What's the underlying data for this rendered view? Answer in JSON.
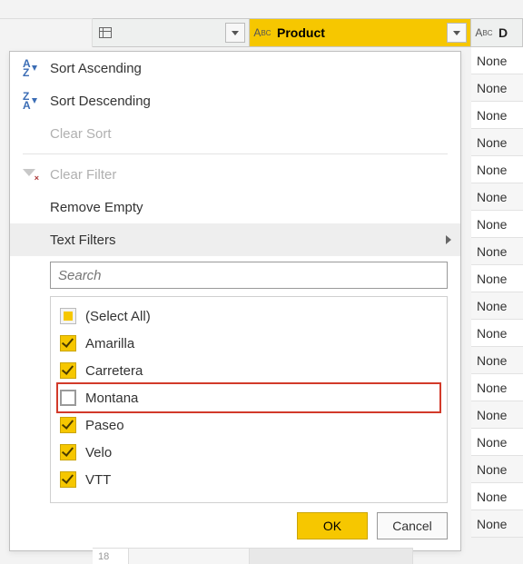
{
  "columns": {
    "first": {
      "type_label": "",
      "label": "",
      "dropdown": true
    },
    "second": {
      "type_label": "ABC",
      "label": "Product",
      "dropdown": true
    },
    "third": {
      "type_label": "ABC",
      "label": "D",
      "dropdown": false
    }
  },
  "visible_cells": [
    "None",
    "None",
    "None",
    "None",
    "None",
    "None",
    "None",
    "None",
    "None",
    "None",
    "None",
    "None",
    "None",
    "None",
    "None",
    "None",
    "None",
    "None"
  ],
  "menu": {
    "sort_asc": "Sort Ascending",
    "sort_desc": "Sort Descending",
    "clear_sort": "Clear Sort",
    "clear_filter": "Clear Filter",
    "remove_empty": "Remove Empty",
    "text_filters": "Text Filters"
  },
  "search": {
    "placeholder": "Search"
  },
  "filter_values": [
    {
      "label": "(Select All)",
      "state": "mixed",
      "highlighted": false
    },
    {
      "label": "Amarilla",
      "state": "checked",
      "highlighted": false
    },
    {
      "label": "Carretera",
      "state": "checked",
      "highlighted": false
    },
    {
      "label": "Montana",
      "state": "unchecked",
      "highlighted": true
    },
    {
      "label": "Paseo",
      "state": "checked",
      "highlighted": false
    },
    {
      "label": "Velo",
      "state": "checked",
      "highlighted": false
    },
    {
      "label": "VTT",
      "state": "checked",
      "highlighted": false
    }
  ],
  "buttons": {
    "ok": "OK",
    "cancel": "Cancel"
  },
  "bottom_row_index": "18"
}
